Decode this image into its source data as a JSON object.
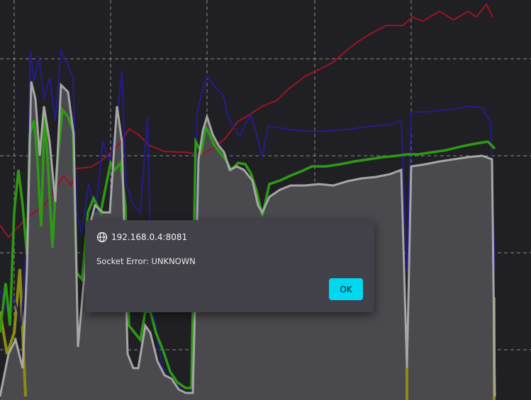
{
  "dialog": {
    "origin": "192.168.0.4:8081",
    "message": "Socket Error: UNKNOWN",
    "ok_label": "OK",
    "icon": "globe-icon",
    "ok_color": "#00d8f0"
  },
  "colors": {
    "background": "#202024",
    "grid": "#8a8a8a",
    "red": "#9a1424",
    "blue": "#241c8a",
    "green": "#2e9a14",
    "gray_line": "#a6a6a6",
    "gray_fill": "#4a4a4e",
    "yellow": "#8c8c10"
  }
}
